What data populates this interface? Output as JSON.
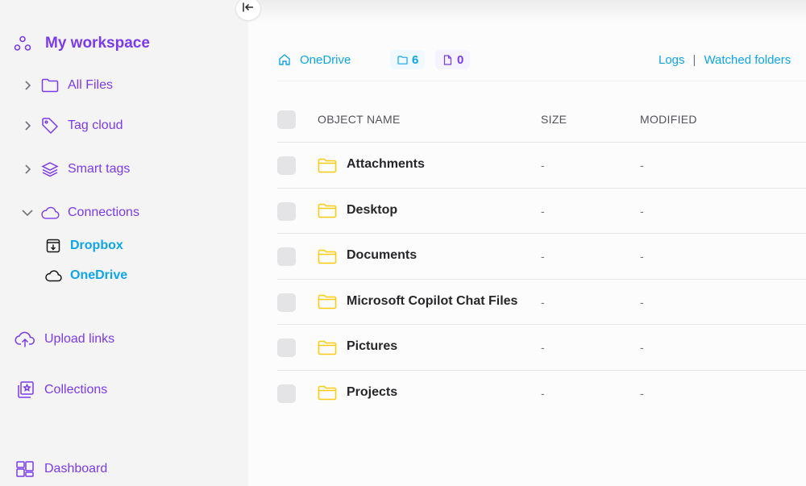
{
  "sidebar": {
    "workspace_title": "My workspace",
    "nav": [
      {
        "label": "All Files",
        "icon": "folder-icon",
        "expanded": false
      },
      {
        "label": "Tag cloud",
        "icon": "tag-icon",
        "expanded": false
      },
      {
        "label": "Smart tags",
        "icon": "layers-icon",
        "expanded": false
      },
      {
        "label": "Connections",
        "icon": "cloud-icon",
        "expanded": true
      }
    ],
    "connections": [
      {
        "label": "Dropbox",
        "icon": "dropbox-icon"
      },
      {
        "label": "OneDrive",
        "icon": "onedrive-cloud-icon"
      }
    ],
    "extra": [
      {
        "label": "Upload links",
        "icon": "cloud-upload-icon"
      },
      {
        "label": "Collections",
        "icon": "collections-icon"
      },
      {
        "label": "Dashboard",
        "icon": "dashboard-icon"
      }
    ]
  },
  "breadcrumb": {
    "current": "OneDrive",
    "folder_count": "6",
    "file_count": "0"
  },
  "links": {
    "logs": "Logs",
    "separator": "|",
    "watched": "Watched folders"
  },
  "table": {
    "headers": {
      "name": "OBJECT NAME",
      "size": "SIZE",
      "modified": "MODIFIED"
    },
    "rows": [
      {
        "name": "Attachments",
        "size": "-",
        "modified": "-"
      },
      {
        "name": "Desktop",
        "size": "-",
        "modified": "-"
      },
      {
        "name": "Documents",
        "size": "-",
        "modified": "-"
      },
      {
        "name": "Microsoft Copilot Chat Files",
        "size": "-",
        "modified": "-"
      },
      {
        "name": "Pictures",
        "size": "-",
        "modified": "-"
      },
      {
        "name": "Projects",
        "size": "-",
        "modified": "-"
      }
    ]
  },
  "colors": {
    "accent_purple": "#7c3aed",
    "accent_blue": "#0ea5e9",
    "folder_yellow": "#facc15"
  }
}
